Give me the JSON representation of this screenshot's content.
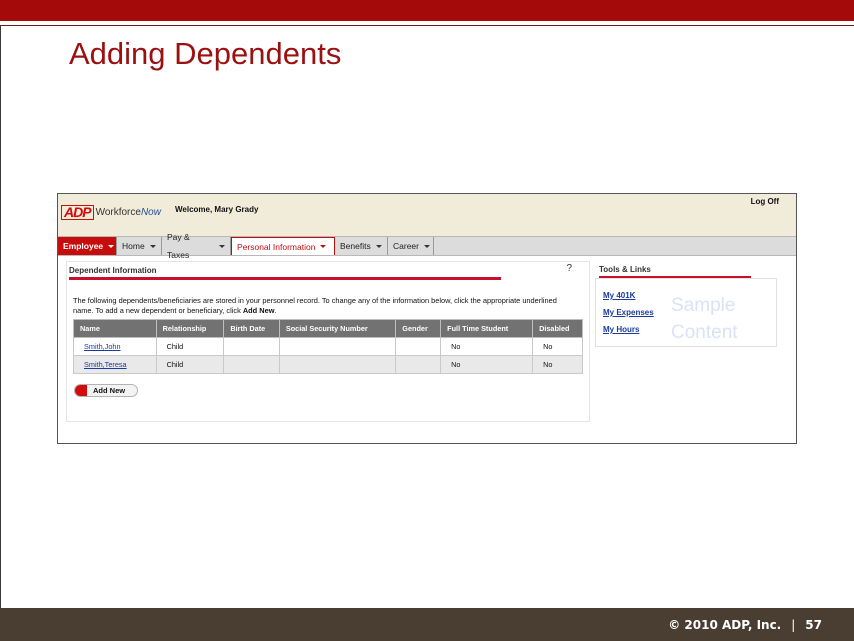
{
  "slide": {
    "title": "Adding Dependents",
    "footer_copyright": "© 2010 ADP, Inc.",
    "footer_separator": "|",
    "page_number": "57"
  },
  "app": {
    "logo_mark": "ADP",
    "logo_workforce": "Workforce",
    "logo_now": "Now",
    "welcome": "Welcome, Mary Grady",
    "logoff": "Log Off"
  },
  "nav": {
    "items": [
      {
        "label": "Employee"
      },
      {
        "label": "Home"
      },
      {
        "label": "Pay & Taxes"
      },
      {
        "label": "Personal Information"
      },
      {
        "label": "Benefits"
      },
      {
        "label": "Career"
      }
    ]
  },
  "dependents": {
    "title": "Dependent Information",
    "help": "?",
    "intro_1": "The following dependents/beneficiaries are stored in your personnel record. To change any of the information below, click the appropriate underlined name. To add a new dependent or beneficiary, click ",
    "intro_bold": "Add New",
    "intro_2": ".",
    "columns": [
      "Name",
      "Relationship",
      "Birth Date",
      "Social Security Number",
      "Gender",
      "Full Time Student",
      "Disabled"
    ],
    "rows": [
      {
        "name": "Smith,John",
        "relationship": "Child",
        "birth_date": "",
        "ssn": "",
        "gender": "",
        "full_time_student": "No",
        "disabled": "No"
      },
      {
        "name": "Smith,Teresa",
        "relationship": "Child",
        "birth_date": "",
        "ssn": "",
        "gender": "",
        "full_time_student": "No",
        "disabled": "No"
      }
    ],
    "add_new_label": "Add New"
  },
  "tools": {
    "title": "Tools & Links",
    "links": [
      "My 401K",
      "My Expenses",
      "My Hours"
    ],
    "watermark_1": "Sample",
    "watermark_2": "Content"
  },
  "colors": {
    "brand_red": "#a50a0a",
    "title_red": "#9b1111",
    "footer_brown": "#4a3e33",
    "link_blue": "#1b3b9e"
  }
}
